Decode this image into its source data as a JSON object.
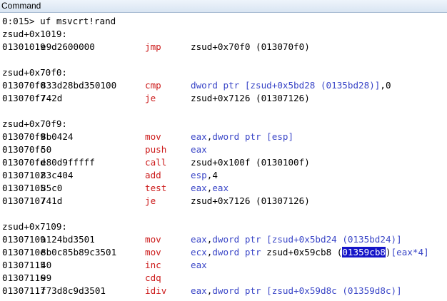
{
  "window": {
    "title": "Command",
    "accent": "#1414c8",
    "mnemonic_color": "#cc1a1a",
    "register_color": "#3a46c7"
  },
  "command": {
    "prompt": "0:015> ",
    "text": "uf msvcrt!rand"
  },
  "blocks": [
    {
      "label": "zsud+0x1019:",
      "rows": [
        {
          "addr": "01301019",
          "bytes": "e9d2600000",
          "mnemonic": "jmp",
          "operands": [
            {
              "t": "zsud+0x70f0 (013070f0)",
              "c": "plain"
            }
          ]
        }
      ]
    },
    {
      "label": "zsud+0x70f0:",
      "rows": [
        {
          "addr": "013070f0",
          "bytes": "833d28bd350100",
          "mnemonic": "cmp",
          "operands": [
            {
              "t": "dword ptr [zsud+0x5bd28 (0135bd28)]",
              "c": "kw"
            },
            {
              "t": ",0",
              "c": "plain"
            }
          ]
        },
        {
          "addr": "013070f7",
          "bytes": "742d",
          "mnemonic": "je",
          "operands": [
            {
              "t": "zsud+0x7126 (01307126)",
              "c": "plain"
            }
          ]
        }
      ]
    },
    {
      "label": "zsud+0x70f9:",
      "rows": [
        {
          "addr": "013070f9",
          "bytes": "8b0424",
          "mnemonic": "mov",
          "operands": [
            {
              "t": "eax",
              "c": "kw"
            },
            {
              "t": ",",
              "c": "plain"
            },
            {
              "t": "dword ptr [esp]",
              "c": "kw"
            }
          ]
        },
        {
          "addr": "013070fc",
          "bytes": "50",
          "mnemonic": "push",
          "operands": [
            {
              "t": "eax",
              "c": "kw"
            }
          ]
        },
        {
          "addr": "013070fd",
          "bytes": "e80d9fffff",
          "mnemonic": "call",
          "operands": [
            {
              "t": "zsud+0x100f (0130100f)",
              "c": "plain"
            }
          ]
        },
        {
          "addr": "01307102",
          "bytes": "83c404",
          "mnemonic": "add",
          "operands": [
            {
              "t": "esp",
              "c": "kw"
            },
            {
              "t": ",4",
              "c": "plain"
            }
          ]
        },
        {
          "addr": "01307105",
          "bytes": "85c0",
          "mnemonic": "test",
          "operands": [
            {
              "t": "eax",
              "c": "kw"
            },
            {
              "t": ",",
              "c": "plain"
            },
            {
              "t": "eax",
              "c": "kw"
            }
          ]
        },
        {
          "addr": "01307107",
          "bytes": "741d",
          "mnemonic": "je",
          "operands": [
            {
              "t": "zsud+0x7126 (01307126)",
              "c": "plain"
            }
          ]
        }
      ]
    },
    {
      "label": "zsud+0x7109:",
      "rows": [
        {
          "addr": "01307109",
          "bytes": "a124bd3501",
          "mnemonic": "mov",
          "operands": [
            {
              "t": "eax",
              "c": "kw"
            },
            {
              "t": ",",
              "c": "plain"
            },
            {
              "t": "dword ptr [zsud+0x5bd24 (0135bd24)]",
              "c": "kw"
            }
          ]
        },
        {
          "addr": "0130710e",
          "bytes": "8b0c85b89c3501",
          "mnemonic": "mov",
          "operands": [
            {
              "t": "ecx",
              "c": "kw"
            },
            {
              "t": ",",
              "c": "plain"
            },
            {
              "t": "dword ptr",
              "c": "kw"
            },
            {
              "t": " zsud+0x59cb8 (",
              "c": "plain"
            },
            {
              "t": "01359cb8",
              "c": "hl"
            },
            {
              "t": ")",
              "c": "plain"
            },
            {
              "t": "[eax*4]",
              "c": "kw"
            }
          ]
        },
        {
          "addr": "01307115",
          "bytes": "40",
          "mnemonic": "inc",
          "operands": [
            {
              "t": "eax",
              "c": "kw"
            }
          ]
        },
        {
          "addr": "01307116",
          "bytes": "99",
          "mnemonic": "cdq",
          "operands": []
        },
        {
          "addr": "01307117",
          "bytes": "f73d8c9d3501",
          "mnemonic": "idiv",
          "operands": [
            {
              "t": "eax",
              "c": "kw"
            },
            {
              "t": ",",
              "c": "plain"
            },
            {
              "t": "dword ptr [zsud+0x59d8c (01359d8c)]",
              "c": "kw"
            }
          ]
        }
      ]
    }
  ]
}
